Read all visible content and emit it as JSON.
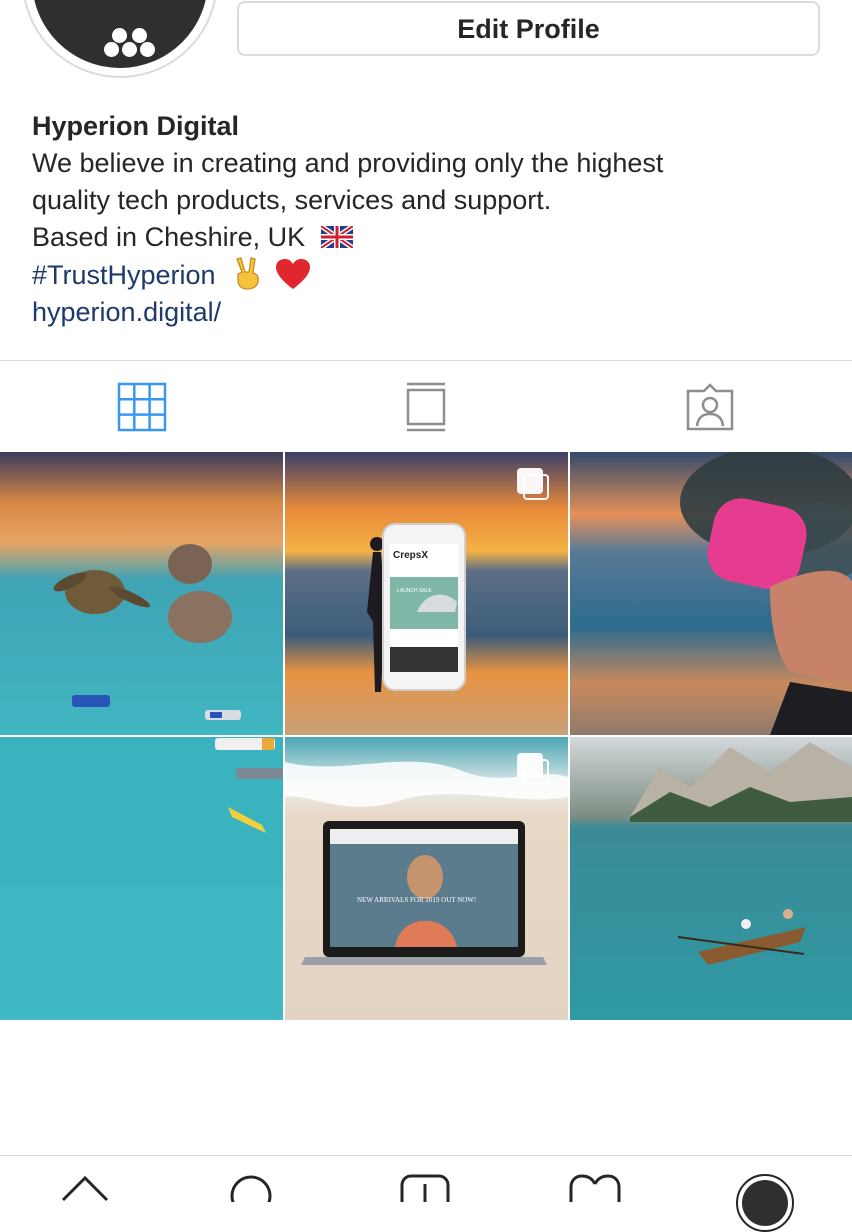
{
  "profile": {
    "edit_button_label": "Edit Profile",
    "name": "Hyperion Digital",
    "bio_line1": "We believe in creating and providing only the highest",
    "bio_line2": "quality tech products, services and support.",
    "bio_line3": "Based in Cheshire, UK",
    "bio_line3_emoji": "uk-flag",
    "hashtag": "#TrustHyperion",
    "hashtag_emojis": [
      "victory-hand",
      "red-heart"
    ],
    "website": "hyperion.digital/"
  },
  "tabs": [
    {
      "name": "grid-view",
      "icon": "grid-icon",
      "active": true
    },
    {
      "name": "feed-view",
      "icon": "feed-icon",
      "active": false
    },
    {
      "name": "tagged",
      "icon": "tagged-person-icon",
      "active": false
    }
  ],
  "posts": [
    {
      "subject": "sea turtle and rocks at sunset aerial beach",
      "multiple": false
    },
    {
      "subject": "phone showing CrepsX site on beach at sunset",
      "multiple": true,
      "phone_brand": "CrepsX",
      "phone_banner": "LAUNCH SALE"
    },
    {
      "subject": "person in pink helmet with smoke over sea",
      "multiple": false
    },
    {
      "subject": "turquoise water with small boats aerial",
      "multiple": false
    },
    {
      "subject": "laptop showing fashion site on sandy beach",
      "multiple": true,
      "laptop_headline": "NEW ARRIVALS FOR 2019 OUT NOW!"
    },
    {
      "subject": "rowing boat on mountain lake",
      "multiple": false
    }
  ],
  "bottom_nav": [
    "home-icon",
    "search-icon",
    "add-post-icon",
    "activity-heart-icon",
    "profile-avatar-icon"
  ],
  "colors": {
    "accent": "#3897f0",
    "link": "#1e3a6b",
    "border": "#dbdbdb",
    "icon_gray": "#8e8e8e"
  }
}
